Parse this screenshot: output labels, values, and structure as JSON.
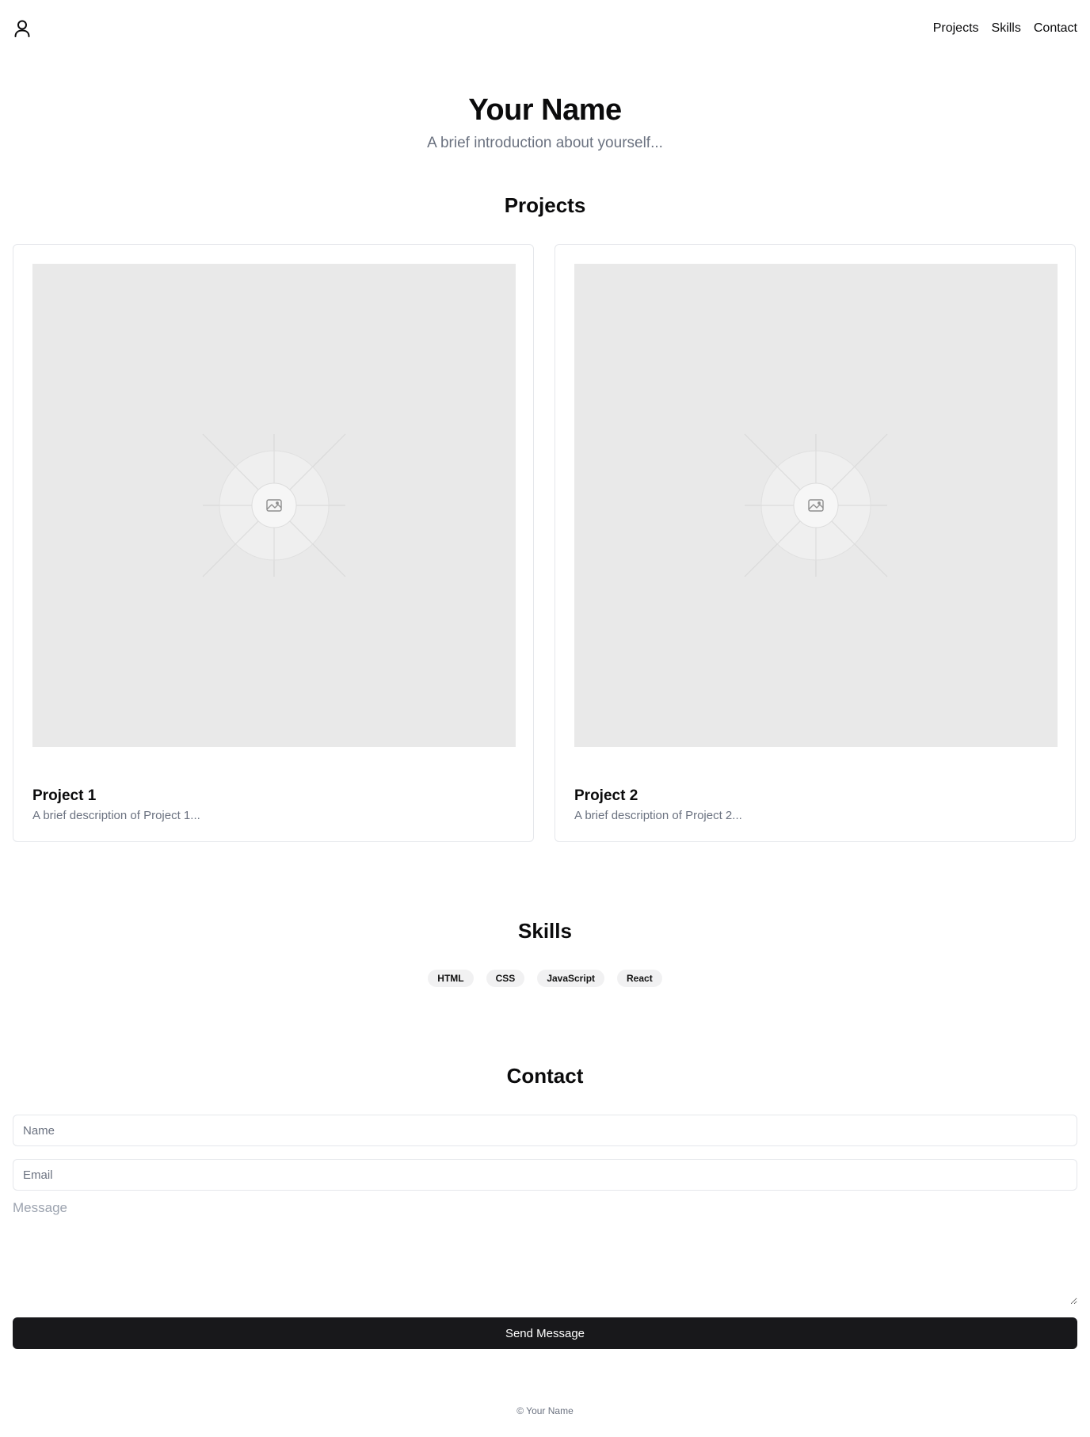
{
  "header": {
    "logo_icon": "user-icon",
    "nav": [
      {
        "label": "Projects"
      },
      {
        "label": "Skills"
      },
      {
        "label": "Contact"
      }
    ]
  },
  "hero": {
    "name": "Your Name",
    "intro": "A brief introduction about yourself..."
  },
  "projects": {
    "heading": "Projects",
    "items": [
      {
        "title": "Project 1",
        "description": "A brief description of Project 1...",
        "image_icon": "image-placeholder-icon"
      },
      {
        "title": "Project 2",
        "description": "A brief description of Project 2...",
        "image_icon": "image-placeholder-icon"
      }
    ]
  },
  "skills": {
    "heading": "Skills",
    "items": [
      "HTML",
      "CSS",
      "JavaScript",
      "React"
    ]
  },
  "contact": {
    "heading": "Contact",
    "name_placeholder": "Name",
    "email_placeholder": "Email",
    "message_placeholder": "Message",
    "send_label": "Send Message"
  },
  "footer": {
    "text": "© Your Name"
  },
  "colors": {
    "text": "#0b0b0c",
    "muted": "#6b7280",
    "border": "#e5e7eb",
    "button_bg": "#18181b",
    "chip_bg": "#f1f1f2",
    "image_bg": "#e9e9e9"
  }
}
